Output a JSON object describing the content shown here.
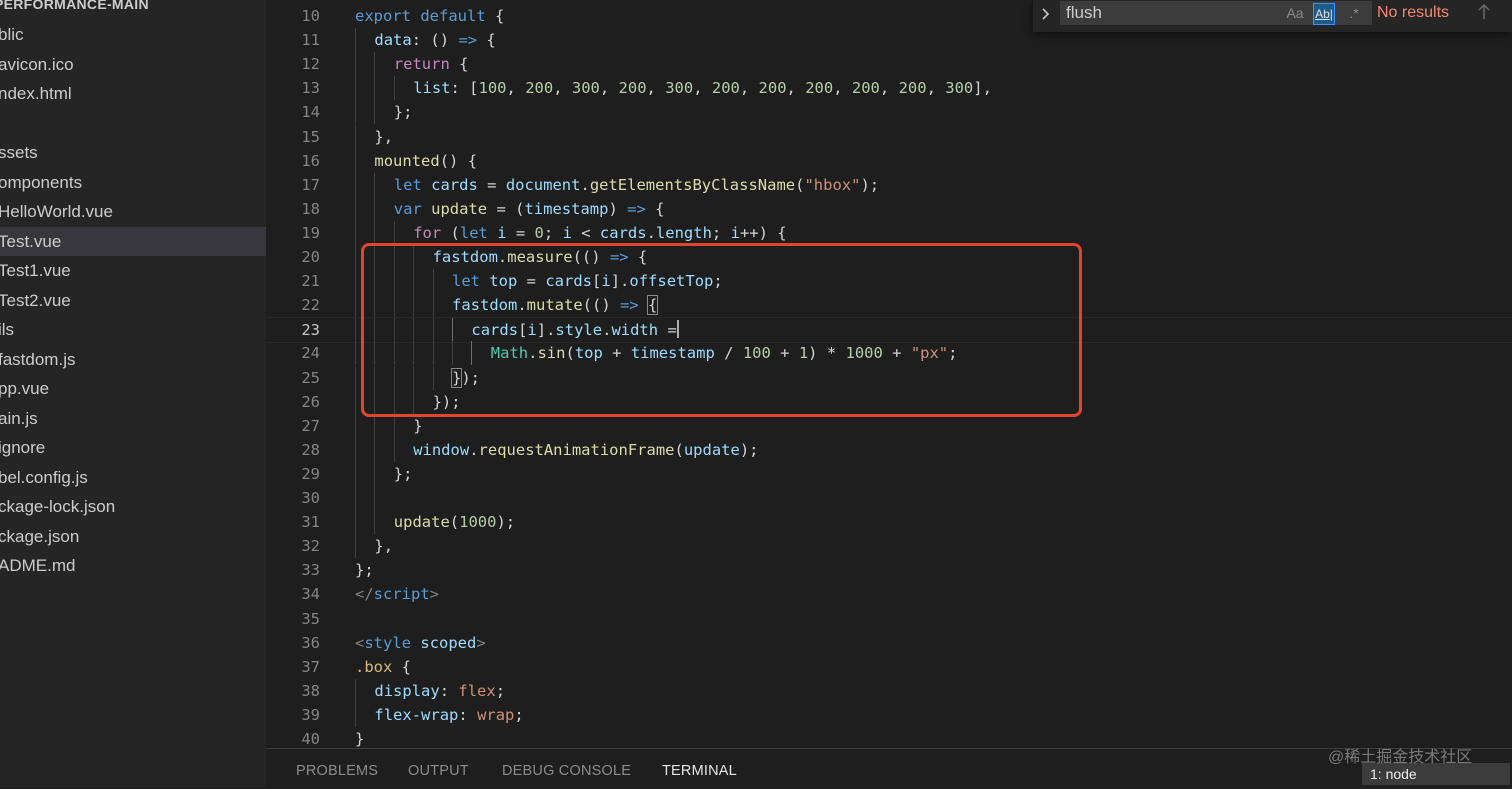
{
  "explorer": {
    "folder_title": "PERFORMANCE-MAIN",
    "items": [
      {
        "label": "blic"
      },
      {
        "label": "avicon.ico"
      },
      {
        "label": "ndex.html"
      },
      {
        "label": ""
      },
      {
        "label": "ssets"
      },
      {
        "label": "omponents"
      },
      {
        "label": "HelloWorld.vue"
      },
      {
        "label": "Test.vue",
        "selected": true
      },
      {
        "label": "Test1.vue"
      },
      {
        "label": "Test2.vue"
      },
      {
        "label": "ils"
      },
      {
        "label": "fastdom.js"
      },
      {
        "label": "pp.vue"
      },
      {
        "label": "ain.js"
      },
      {
        "label": "ignore"
      },
      {
        "label": "bel.config.js"
      },
      {
        "label": "ckage-lock.json"
      },
      {
        "label": "ckage.json"
      },
      {
        "label": "ADME.md"
      }
    ]
  },
  "find_widget": {
    "query": "flush",
    "match_case_label": "Aa",
    "whole_word_label": "Ab|",
    "regex_label": ".*",
    "status": "No results",
    "prev_icon": "arrow-up-icon"
  },
  "editor": {
    "current_line": 23,
    "lines": [
      {
        "n": "10",
        "indent": 0,
        "segs": [
          [
            "kw",
            "export"
          ],
          [
            "pun",
            " "
          ],
          [
            "kw",
            "default"
          ],
          [
            "pun",
            " {"
          ]
        ]
      },
      {
        "n": "11",
        "indent": 1,
        "segs": [
          [
            "var",
            "data"
          ],
          [
            "pun",
            ": () "
          ],
          [
            "kw",
            "=>"
          ],
          [
            "pun",
            " {"
          ]
        ]
      },
      {
        "n": "12",
        "indent": 2,
        "segs": [
          [
            "ctl",
            "return"
          ],
          [
            "pun",
            " {"
          ]
        ]
      },
      {
        "n": "13",
        "indent": 3,
        "segs": [
          [
            "var",
            "list"
          ],
          [
            "pun",
            ": ["
          ],
          [
            "num",
            "100"
          ],
          [
            "pun",
            ", "
          ],
          [
            "num",
            "200"
          ],
          [
            "pun",
            ", "
          ],
          [
            "num",
            "300"
          ],
          [
            "pun",
            ", "
          ],
          [
            "num",
            "200"
          ],
          [
            "pun",
            ", "
          ],
          [
            "num",
            "300"
          ],
          [
            "pun",
            ", "
          ],
          [
            "num",
            "200"
          ],
          [
            "pun",
            ", "
          ],
          [
            "num",
            "200"
          ],
          [
            "pun",
            ", "
          ],
          [
            "num",
            "200"
          ],
          [
            "pun",
            ", "
          ],
          [
            "num",
            "200"
          ],
          [
            "pun",
            ", "
          ],
          [
            "num",
            "200"
          ],
          [
            "pun",
            ", "
          ],
          [
            "num",
            "300"
          ],
          [
            "pun",
            "],"
          ]
        ]
      },
      {
        "n": "14",
        "indent": 2,
        "segs": [
          [
            "pun",
            "};"
          ]
        ]
      },
      {
        "n": "15",
        "indent": 1,
        "segs": [
          [
            "pun",
            "},"
          ]
        ]
      },
      {
        "n": "16",
        "indent": 1,
        "segs": [
          [
            "fn",
            "mounted"
          ],
          [
            "pun",
            "() {"
          ]
        ]
      },
      {
        "n": "17",
        "indent": 2,
        "segs": [
          [
            "kw",
            "let"
          ],
          [
            "pun",
            " "
          ],
          [
            "var",
            "cards"
          ],
          [
            "pun",
            " = "
          ],
          [
            "var",
            "document"
          ],
          [
            "pun",
            "."
          ],
          [
            "fn",
            "getElementsByClassName"
          ],
          [
            "pun",
            "("
          ],
          [
            "str",
            "\"hbox\""
          ],
          [
            "pun",
            ");"
          ]
        ]
      },
      {
        "n": "18",
        "indent": 2,
        "segs": [
          [
            "kw",
            "var"
          ],
          [
            "pun",
            " "
          ],
          [
            "fn",
            "update"
          ],
          [
            "pun",
            " = ("
          ],
          [
            "var",
            "timestamp"
          ],
          [
            "pun",
            ") "
          ],
          [
            "kw",
            "=>"
          ],
          [
            "pun",
            " {"
          ]
        ]
      },
      {
        "n": "19",
        "indent": 3,
        "segs": [
          [
            "ctl",
            "for"
          ],
          [
            "pun",
            " ("
          ],
          [
            "kw",
            "let"
          ],
          [
            "pun",
            " "
          ],
          [
            "var",
            "i"
          ],
          [
            "pun",
            " = "
          ],
          [
            "num",
            "0"
          ],
          [
            "pun",
            "; "
          ],
          [
            "var",
            "i"
          ],
          [
            "pun",
            " < "
          ],
          [
            "var",
            "cards"
          ],
          [
            "pun",
            "."
          ],
          [
            "var",
            "length"
          ],
          [
            "pun",
            "; "
          ],
          [
            "var",
            "i"
          ],
          [
            "pun",
            "++) {"
          ]
        ]
      },
      {
        "n": "20",
        "indent": 4,
        "segs": [
          [
            "var",
            "fastdom"
          ],
          [
            "pun",
            "."
          ],
          [
            "fn",
            "measure"
          ],
          [
            "pun",
            "(() "
          ],
          [
            "kw",
            "=>"
          ],
          [
            "pun",
            " {"
          ]
        ]
      },
      {
        "n": "21",
        "indent": 5,
        "segs": [
          [
            "kw",
            "let"
          ],
          [
            "pun",
            " "
          ],
          [
            "var",
            "top"
          ],
          [
            "pun",
            " = "
          ],
          [
            "var",
            "cards"
          ],
          [
            "pun",
            "["
          ],
          [
            "var",
            "i"
          ],
          [
            "pun",
            "]."
          ],
          [
            "var",
            "offsetTop"
          ],
          [
            "pun",
            ";"
          ]
        ]
      },
      {
        "n": "22",
        "indent": 5,
        "segs": [
          [
            "var",
            "fastdom"
          ],
          [
            "pun",
            "."
          ],
          [
            "fn",
            "mutate"
          ],
          [
            "pun",
            "(() "
          ],
          [
            "kw",
            "=>"
          ],
          [
            "pun",
            " "
          ],
          [
            "match",
            "{"
          ]
        ]
      },
      {
        "n": "23",
        "indent": 6,
        "segs": [
          [
            "var",
            "cards"
          ],
          [
            "pun",
            "["
          ],
          [
            "var",
            "i"
          ],
          [
            "pun",
            "]."
          ],
          [
            "var",
            "style"
          ],
          [
            "pun",
            "."
          ],
          [
            "var",
            "width"
          ],
          [
            "pun",
            " ="
          ],
          [
            "cursor",
            ""
          ]
        ]
      },
      {
        "n": "24",
        "indent": 7,
        "segs": [
          [
            "cls",
            "Math"
          ],
          [
            "pun",
            "."
          ],
          [
            "fn",
            "sin"
          ],
          [
            "pun",
            "("
          ],
          [
            "var",
            "top"
          ],
          [
            "pun",
            " + "
          ],
          [
            "var",
            "timestamp"
          ],
          [
            "pun",
            " / "
          ],
          [
            "num",
            "100"
          ],
          [
            "pun",
            " + "
          ],
          [
            "num",
            "1"
          ],
          [
            "pun",
            ") * "
          ],
          [
            "num",
            "1000"
          ],
          [
            "pun",
            " + "
          ],
          [
            "str",
            "\"px\""
          ],
          [
            "pun",
            ";"
          ]
        ]
      },
      {
        "n": "25",
        "indent": 5,
        "segs": [
          [
            "match",
            "}"
          ],
          [
            "pun",
            ");"
          ]
        ]
      },
      {
        "n": "26",
        "indent": 4,
        "segs": [
          [
            "pun",
            "});"
          ]
        ]
      },
      {
        "n": "27",
        "indent": 3,
        "segs": [
          [
            "pun",
            "}"
          ]
        ]
      },
      {
        "n": "28",
        "indent": 3,
        "segs": [
          [
            "var",
            "window"
          ],
          [
            "pun",
            "."
          ],
          [
            "fn",
            "requestAnimationFrame"
          ],
          [
            "pun",
            "("
          ],
          [
            "var",
            "update"
          ],
          [
            "pun",
            ");"
          ]
        ]
      },
      {
        "n": "29",
        "indent": 2,
        "segs": [
          [
            "pun",
            "};"
          ]
        ]
      },
      {
        "n": "30",
        "indent": 2,
        "segs": []
      },
      {
        "n": "31",
        "indent": 2,
        "segs": [
          [
            "fn",
            "update"
          ],
          [
            "pun",
            "("
          ],
          [
            "num",
            "1000"
          ],
          [
            "pun",
            ");"
          ]
        ]
      },
      {
        "n": "32",
        "indent": 1,
        "segs": [
          [
            "pun",
            "},"
          ]
        ]
      },
      {
        "n": "33",
        "indent": 0,
        "segs": [
          [
            "pun",
            "};"
          ]
        ]
      },
      {
        "n": "34",
        "indent": 0,
        "segs": [
          [
            "tag",
            "</"
          ],
          [
            "kw",
            "script"
          ],
          [
            "tag",
            ">"
          ]
        ]
      },
      {
        "n": "35",
        "indent": 0,
        "segs": []
      },
      {
        "n": "36",
        "indent": 0,
        "segs": [
          [
            "tag",
            "<"
          ],
          [
            "kw",
            "style"
          ],
          [
            "pun",
            " "
          ],
          [
            "var",
            "scoped"
          ],
          [
            "tag",
            ">"
          ]
        ]
      },
      {
        "n": "37",
        "indent": 0,
        "segs": [
          [
            "sel",
            ".box"
          ],
          [
            "pun",
            " {"
          ]
        ]
      },
      {
        "n": "38",
        "indent": 1,
        "segs": [
          [
            "var",
            "display"
          ],
          [
            "pun",
            ": "
          ],
          [
            "str",
            "flex"
          ],
          [
            "pun",
            ";"
          ]
        ]
      },
      {
        "n": "39",
        "indent": 1,
        "segs": [
          [
            "var",
            "flex-wrap"
          ],
          [
            "pun",
            ": "
          ],
          [
            "str",
            "wrap"
          ],
          [
            "pun",
            ";"
          ]
        ]
      },
      {
        "n": "40",
        "indent": 0,
        "segs": [
          [
            "pun",
            "}"
          ]
        ]
      }
    ]
  },
  "panel": {
    "tabs": [
      "PROBLEMS",
      "OUTPUT",
      "DEBUG CONSOLE",
      "TERMINAL"
    ],
    "active_tab": "TERMINAL",
    "terminal_select": "1: node"
  },
  "watermark": "@稀土掘金技术社区",
  "colors": {
    "highlight_box": "#e0452f",
    "editor_bg": "#1e1e1e",
    "sidebar_bg": "#252526"
  }
}
